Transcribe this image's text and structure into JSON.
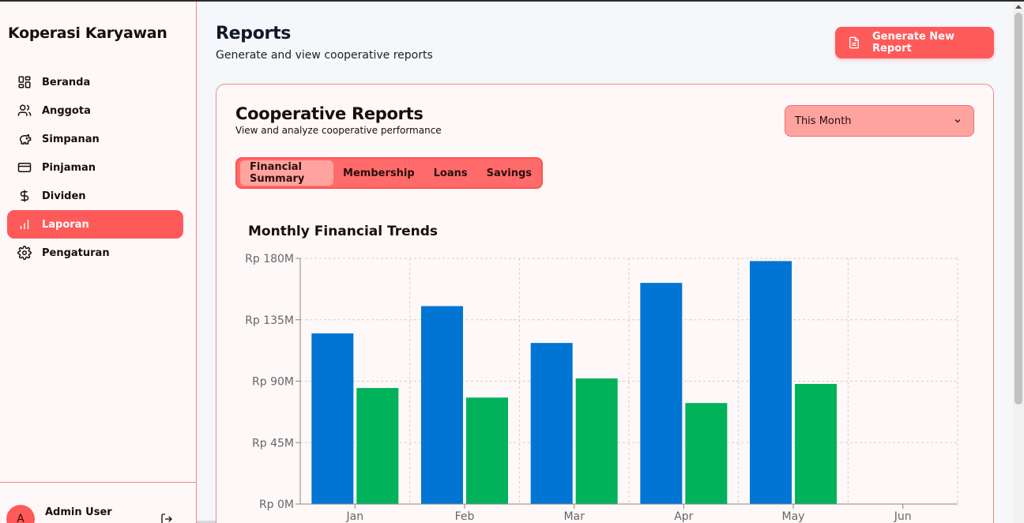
{
  "app": {
    "brand": "Koperasi Karyawan"
  },
  "sidebar": {
    "items": [
      {
        "label": "Beranda",
        "icon": "grid-icon"
      },
      {
        "label": "Anggota",
        "icon": "users-icon"
      },
      {
        "label": "Simpanan",
        "icon": "piggy-bank-icon"
      },
      {
        "label": "Pinjaman",
        "icon": "credit-card-icon"
      },
      {
        "label": "Dividen",
        "icon": "dollar-icon"
      },
      {
        "label": "Laporan",
        "icon": "bar-chart-icon",
        "active": true
      },
      {
        "label": "Pengaturan",
        "icon": "gear-icon"
      }
    ],
    "user": {
      "initial": "A",
      "name": "Admin User"
    }
  },
  "header": {
    "title": "Reports",
    "subtitle": "Generate and view cooperative reports",
    "generate_button": "Generate New Report"
  },
  "card": {
    "title": "Cooperative Reports",
    "subtitle": "View and analyze cooperative performance",
    "period": "This Month",
    "tabs": [
      {
        "label": "Financial Summary",
        "active": true
      },
      {
        "label": "Membership"
      },
      {
        "label": "Loans"
      },
      {
        "label": "Savings"
      }
    ]
  },
  "colors": {
    "accent": "#ff5a5a",
    "series_blue": "#0075d4",
    "series_green": "#00b259"
  },
  "chart_data": {
    "type": "bar",
    "title": "Monthly Financial Trends",
    "categories": [
      "Jan",
      "Feb",
      "Mar",
      "Apr",
      "May",
      "Jun"
    ],
    "series": [
      {
        "values": [
          125000000,
          145000000,
          118000000,
          162000000,
          178000000,
          null
        ],
        "color": "#0075d4"
      },
      {
        "values": [
          85000000,
          78000000,
          92000000,
          74000000,
          88000000,
          null
        ],
        "color": "#00b259"
      }
    ],
    "yticks": [
      0,
      45000000,
      90000000,
      135000000,
      180000000
    ],
    "ytick_labels": [
      "Rp 0M",
      "Rp 45M",
      "Rp 90M",
      "Rp 135M",
      "Rp 180M"
    ],
    "ylim": [
      0,
      180000000
    ],
    "grid": true
  }
}
